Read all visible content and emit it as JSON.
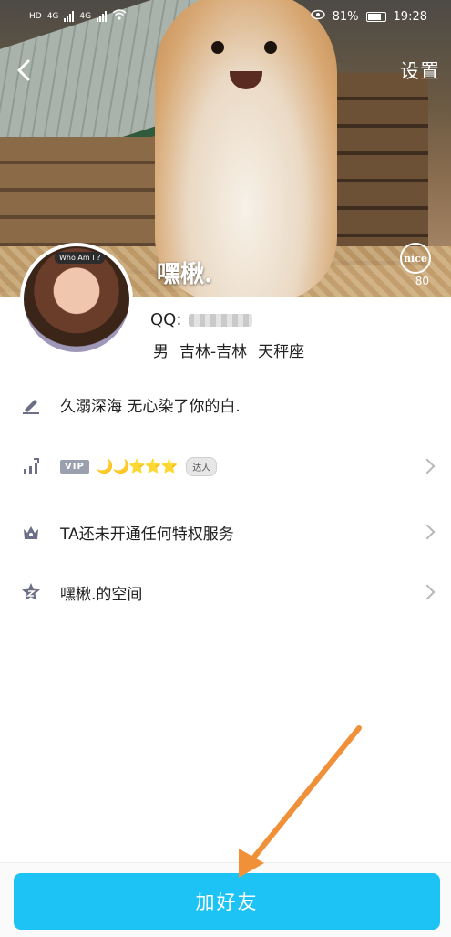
{
  "status_bar": {
    "left_labels": [
      "HD",
      "4G",
      "4G"
    ],
    "battery": "81%",
    "time": "19:28"
  },
  "nav": {
    "back_icon": "chevron-left-icon",
    "settings_label": "设置"
  },
  "cover": {
    "nickname": "嘿楸.",
    "nice_label": "nice",
    "nice_count": "80"
  },
  "avatar": {
    "tag": "Who Am I ?"
  },
  "profile": {
    "qq_label": "QQ:",
    "gender": "男",
    "location": "吉林-吉林",
    "zodiac": "天秤座"
  },
  "list": [
    {
      "icon": "pencil-icon",
      "text": "久溺深海 无心染了你的白."
    },
    {
      "icon": "chart-up-icon",
      "vip_label": "VIP",
      "level_icons": "🌙🌙⭐⭐⭐",
      "daren_label": "达人"
    },
    {
      "icon": "crown-icon",
      "text": "TA还未开通任何特权服务"
    },
    {
      "icon": "star-icon",
      "text": "嘿楸.的空间"
    }
  ],
  "bottom": {
    "add_friend_label": "加好友"
  },
  "colors": {
    "accent": "#1ec3f6",
    "annotation_arrow": "#f0913a"
  }
}
